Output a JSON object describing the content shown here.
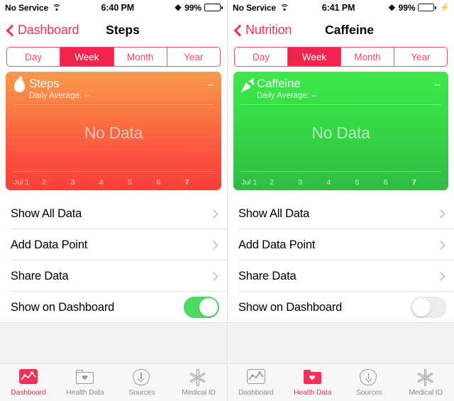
{
  "panels": [
    {
      "status": {
        "carrier": "No Service",
        "wifi_icon": "wifi-icon",
        "time": "6:40 PM",
        "bluetooth_icon": "bluetooth-icon",
        "battery_percent": "99%",
        "battery_state": "normal"
      },
      "nav": {
        "back_label": "Dashboard",
        "back_icon": "chevron-left-icon",
        "title": "Steps"
      },
      "segments": {
        "options": [
          "Day",
          "Week",
          "Month",
          "Year"
        ],
        "selected": "Week"
      },
      "card": {
        "icon": "flame-icon",
        "title": "Steps",
        "subtitle": "Daily Average: --",
        "value": "--",
        "empty_text": "No Data",
        "axis_labels": [
          "Jul 1",
          "2",
          "3",
          "4",
          "5",
          "6",
          "7"
        ],
        "gradient_from": "#FA9A4B",
        "gradient_to": "#FA4038"
      },
      "rows": [
        {
          "label": "Show All Data",
          "accessory": "chevron"
        },
        {
          "label": "Add Data Point",
          "accessory": "chevron"
        },
        {
          "label": "Share Data",
          "accessory": "chevron"
        },
        {
          "label": "Show on Dashboard",
          "accessory": "switch",
          "switch_on": true
        }
      ],
      "tabs": [
        {
          "label": "Dashboard",
          "icon": "dashboard-chart-icon",
          "active": true
        },
        {
          "label": "Health Data",
          "icon": "folder-heart-icon",
          "active": false
        },
        {
          "label": "Sources",
          "icon": "download-arrow-icon",
          "active": false
        },
        {
          "label": "Medical ID",
          "icon": "star-of-life-icon",
          "active": false
        }
      ]
    },
    {
      "status": {
        "carrier": "No Service",
        "wifi_icon": "wifi-icon",
        "time": "6:41 PM",
        "bluetooth_icon": "bluetooth-icon",
        "battery_percent": "99%",
        "battery_state": "charging"
      },
      "nav": {
        "back_label": "Nutrition",
        "back_icon": "chevron-left-icon",
        "title": "Caffeine"
      },
      "segments": {
        "options": [
          "Day",
          "Week",
          "Month",
          "Year"
        ],
        "selected": "Week"
      },
      "card": {
        "icon": "carrot-icon",
        "title": "Caffeine",
        "subtitle": "Daily Average: --",
        "value": "--",
        "empty_text": "No Data",
        "axis_labels": [
          "Jul 1",
          "2",
          "3",
          "4",
          "5",
          "6",
          "7"
        ],
        "gradient_from": "#3DE84A",
        "gradient_to": "#2FBC42"
      },
      "rows": [
        {
          "label": "Show All Data",
          "accessory": "chevron"
        },
        {
          "label": "Add Data Point",
          "accessory": "chevron"
        },
        {
          "label": "Share Data",
          "accessory": "chevron"
        },
        {
          "label": "Show on Dashboard",
          "accessory": "switch",
          "switch_on": false
        }
      ],
      "tabs": [
        {
          "label": "Dashboard",
          "icon": "dashboard-chart-icon",
          "active": false
        },
        {
          "label": "Health Data",
          "icon": "folder-heart-icon",
          "active": true
        },
        {
          "label": "Sources",
          "icon": "download-arrow-icon",
          "active": false
        },
        {
          "label": "Medical ID",
          "icon": "star-of-life-icon",
          "active": false
        }
      ]
    }
  ],
  "colors": {
    "accent_red": "#F2315A",
    "segment_selected": "#F4234B",
    "switch_on": "#4CD964",
    "battery_charging": "#4CD545"
  }
}
